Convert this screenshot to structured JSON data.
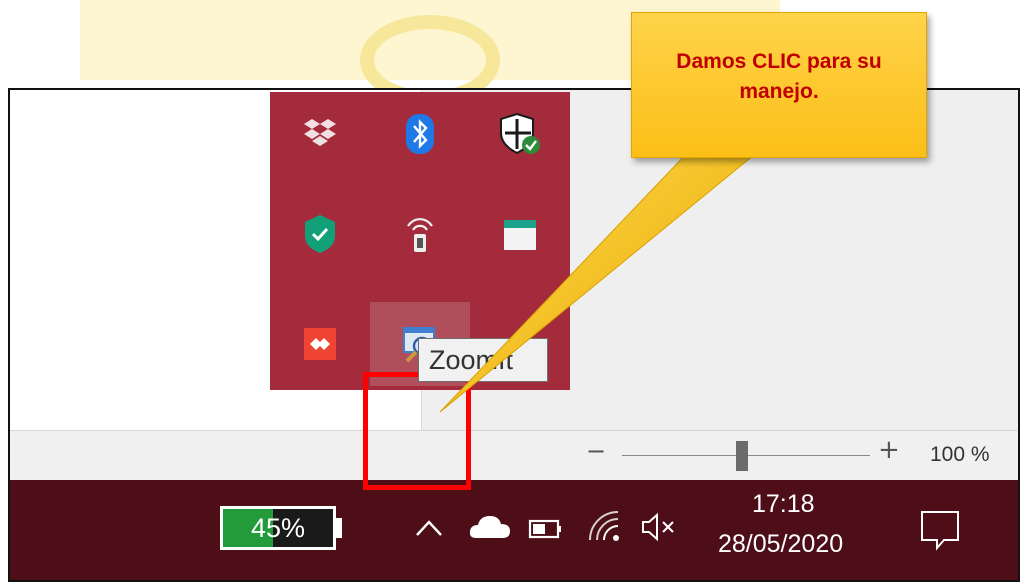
{
  "callout": {
    "line1": "Damos CLIC para su",
    "line2": "manejo."
  },
  "tooltip": {
    "text": "ZoomIt"
  },
  "statusbar": {
    "zoom_minus": "−",
    "zoom_plus": "+",
    "zoom_value": "100 %",
    "zoom_level_percent": 100
  },
  "taskbar": {
    "battery_text": "45%",
    "battery_level_percent": 45,
    "time": "17:18",
    "date": "28/05/2020"
  },
  "tray_icons": [
    {
      "name": "dropbox-icon",
      "color": "#ffffff"
    },
    {
      "name": "bluetooth-icon",
      "color": "#1e78e6"
    },
    {
      "name": "windows-security-icon",
      "color": "#2e8b3a"
    },
    {
      "name": "kaspersky-shield-icon",
      "color": "#12a079"
    },
    {
      "name": "wireless-display-icon",
      "color": "#ffffff"
    },
    {
      "name": "app-icon",
      "color": "#1aa38a"
    },
    {
      "name": "anydesk-icon",
      "color": "#ef4433"
    },
    {
      "name": "zoomit-icon",
      "color": "#3f7fd0"
    }
  ],
  "colors": {
    "taskbar": "#4e0e18",
    "tray_popup": "#a42b3c",
    "highlight": "#ff0000",
    "callout": "#fbbf17",
    "callout_text": "#c00000"
  }
}
